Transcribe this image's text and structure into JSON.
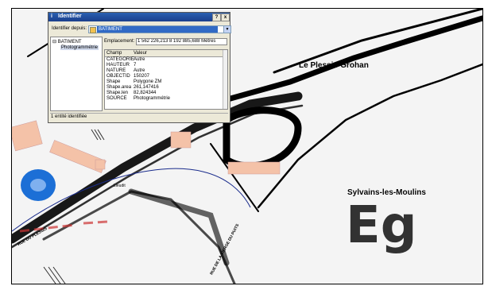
{
  "dialog": {
    "title": "Identifier",
    "title_icon": "i",
    "help_button": "?",
    "close_button": "x",
    "identify_from_label": "Identifier depuis:",
    "identify_from_value": "BATIMENT",
    "tree_root": "BATIMENT",
    "tree_child": "Photogrammétrie",
    "location_label": "Emplacement:",
    "location_value": "1 562 226,213  8 192 885,688 Mètres",
    "table_headers": [
      "Champ",
      "Valeur"
    ],
    "rows": [
      {
        "field": "CATEGORIE",
        "value": "Autre"
      },
      {
        "field": "HAUTEUR",
        "value": "7"
      },
      {
        "field": "NATURE",
        "value": "Autre"
      },
      {
        "field": "OBJECTID",
        "value": "150207"
      },
      {
        "field": "Shape",
        "value": "Polygone ZM"
      },
      {
        "field": "Shape.area",
        "value": "261,147416"
      },
      {
        "field": "Shape.len",
        "value": "82,824344"
      },
      {
        "field": "SOURCE",
        "value": "Photogrammétrie"
      }
    ],
    "status": "1 entité identifiée"
  },
  "map": {
    "labels": {
      "plessis": "Le Plessis-Grohan",
      "sylvains": "Sylvains-les-Moulins",
      "big": "Eg",
      "road_left": "RUE DU PLESSIS",
      "road_center": "RUE DE LA VIERGE DU PUITS",
      "small": "Lieudit"
    },
    "colors": {
      "building": "#f4c2a8",
      "water": "#1c6fd6",
      "road_outline": "#000000",
      "blue_line": "#1a2c8c",
      "red_line": "#cc3333"
    }
  }
}
